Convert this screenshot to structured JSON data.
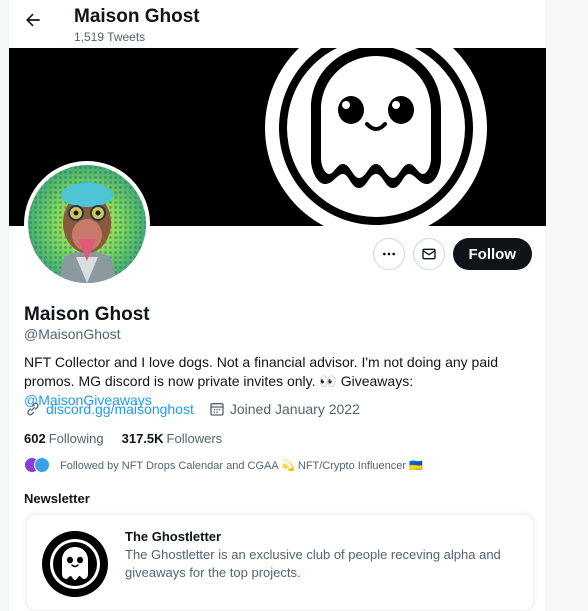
{
  "header": {
    "title": "Maison Ghost",
    "tweet_count": "1,519 Tweets"
  },
  "profile": {
    "name": "Maison Ghost",
    "handle": "@MaisonGhost",
    "bio_text": "NFT Collector and I love dogs. Not a financial advisor. I'm not doing any paid promos. MG discord is now private invites only. 👀 Giveaways: ",
    "bio_link": "@MaisonGiveaways",
    "website": "discord.gg/maisonghost",
    "joined": "Joined January 2022",
    "following_count": "602",
    "following_label": "Following",
    "followers_count": "317.5K",
    "followers_label": "Followers",
    "followed_by": "Followed by NFT Drops Calendar and CGAA 💫 NFT/Crypto Influencer 🇺🇦"
  },
  "actions": {
    "follow_label": "Follow"
  },
  "newsletter": {
    "heading": "Newsletter",
    "title": "The Ghostletter",
    "description": "The Ghostletter is an exclusive club of people receving alpha and giveaways for the top projects."
  },
  "colors": {
    "accent": "#1d9bf0",
    "text": "#0f1419",
    "muted": "#536471",
    "button_dark": "#0f1419"
  },
  "icons": [
    "back-arrow-icon",
    "more-icon",
    "message-icon",
    "link-icon",
    "calendar-icon"
  ]
}
